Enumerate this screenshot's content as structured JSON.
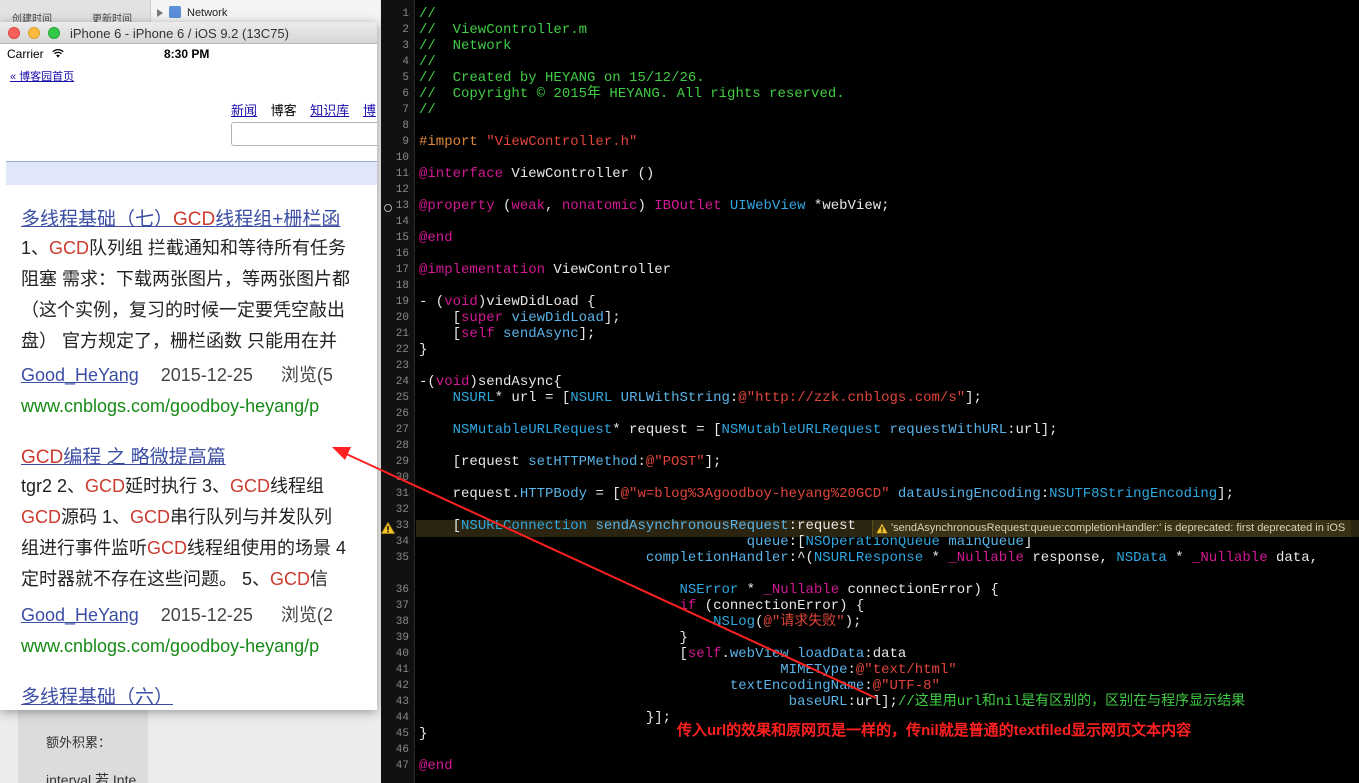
{
  "background": {
    "tab_left": "创建时间",
    "tab_right": "更新时间",
    "navigator_group": "Network",
    "lower_label": "额外积累：",
    "lower_text": "interval 若 Inte..."
  },
  "simulator": {
    "title": "iPhone 6 - iPhone 6 / iOS 9.2 (13C75)",
    "carrier": "Carrier",
    "time": "8:30 PM"
  },
  "webpage": {
    "home_link": "« 博客园首页",
    "nav": [
      "新闻",
      "博客",
      "知识库",
      "博"
    ],
    "results": [
      {
        "title_parts": [
          "多线程基础（七）",
          "GCD",
          "线程组+栅栏函"
        ],
        "lines": [
          [
            "1、",
            "GCD",
            "队列组 拦截通知和等待所有任务"
          ],
          [
            "阻塞 需求：下载两张图片，等两张图片都"
          ],
          [
            "（这个实例，复习的时候一定要凭空敲出"
          ],
          [
            "盘） 官方规定了，栅栏函数 只能用在并"
          ]
        ],
        "author": "Good_HeYang",
        "date": "2015-12-25",
        "views": "浏览(5",
        "url": "www.cnblogs.com/goodboy-heyang/p"
      },
      {
        "title_parts": [
          "GCD",
          "编程 之 略微提高篇"
        ],
        "lines": [
          [
            "tgr2 2、",
            "GCD",
            "延时执行 3、",
            "GCD",
            "线程组"
          ],
          [
            "GCD",
            "源码 1、",
            "GCD",
            "串行队列与并发队列"
          ],
          [
            "组进行事件监听",
            "GCD",
            "线程组使用的场景 4"
          ],
          [
            "定时器就不存在这些问题。 5、",
            "GCD",
            "信"
          ]
        ],
        "author": "Good_HeYang",
        "date": "2015-12-25",
        "views": "浏览(2",
        "url": "www.cnblogs.com/goodboy-heyang/p"
      },
      {
        "title_parts": [
          "多线程基础（六）"
        ]
      }
    ]
  },
  "editor": {
    "line_numbers": [
      "1",
      "2",
      "3",
      "4",
      "5",
      "6",
      "7",
      "8",
      "9",
      "10",
      "11",
      "12",
      "13",
      "14",
      "15",
      "16",
      "17",
      "18",
      "19",
      "20",
      "21",
      "22",
      "23",
      "24",
      "25",
      "26",
      "27",
      "28",
      "29",
      "30",
      "31",
      "32",
      "33",
      "34",
      "35",
      "36",
      "37",
      "38",
      "39",
      "40",
      "41",
      "42",
      "43",
      "44",
      "45",
      "46",
      "47"
    ],
    "code": [
      [
        [
          "c",
          "//"
        ]
      ],
      [
        [
          "c",
          "//  ViewController.m"
        ]
      ],
      [
        [
          "c",
          "//  Network"
        ]
      ],
      [
        [
          "c",
          "//"
        ]
      ],
      [
        [
          "c",
          "//  Created by HEYANG on 15/12/26."
        ]
      ],
      [
        [
          "c",
          "//  Copyright © 2015年 HEYANG. All rights reserved."
        ]
      ],
      [
        [
          "c",
          "//"
        ]
      ],
      [],
      [
        [
          "pp",
          "#import "
        ],
        [
          "s",
          "\"ViewController.h\""
        ]
      ],
      [],
      [
        [
          "k",
          "@interface "
        ],
        [
          "w",
          "ViewController ()"
        ]
      ],
      [],
      [
        [
          "k",
          "@property "
        ],
        [
          "w",
          "("
        ],
        [
          "k",
          "weak"
        ],
        [
          "w",
          ", "
        ],
        [
          "k",
          "nonatomic"
        ],
        [
          "w",
          ") "
        ],
        [
          "k",
          "IBOutlet "
        ],
        [
          "t2",
          "UIWebView "
        ],
        [
          "w",
          "*webView;"
        ]
      ],
      [],
      [
        [
          "k",
          "@end"
        ]
      ],
      [],
      [
        [
          "k",
          "@implementation "
        ],
        [
          "w",
          "ViewController"
        ]
      ],
      [],
      [
        [
          "w",
          "- ("
        ],
        [
          "k",
          "void"
        ],
        [
          "w",
          ")viewDidLoad {"
        ]
      ],
      [
        [
          "w",
          "    ["
        ],
        [
          "k",
          "super "
        ],
        [
          "m",
          "viewDidLoad"
        ],
        [
          "w",
          "];"
        ]
      ],
      [
        [
          "w",
          "    ["
        ],
        [
          "k",
          "self "
        ],
        [
          "m",
          "sendAsync"
        ],
        [
          "w",
          "];"
        ]
      ],
      [
        [
          "w",
          "}"
        ]
      ],
      [],
      [
        [
          "w",
          "-("
        ],
        [
          "k",
          "void"
        ],
        [
          "w",
          ")sendAsync{"
        ]
      ],
      [
        [
          "w",
          "    "
        ],
        [
          "t2",
          "NSURL"
        ],
        [
          "w",
          "* url = ["
        ],
        [
          "t2",
          "NSURL "
        ],
        [
          "m",
          "URLWithString"
        ],
        [
          "w",
          ":"
        ],
        [
          "s",
          "@\"http://zzk.cnblogs.com/s\""
        ],
        [
          "w",
          "];"
        ]
      ],
      [],
      [
        [
          "w",
          "    "
        ],
        [
          "t2",
          "NSMutableURLRequest"
        ],
        [
          "w",
          "* request = ["
        ],
        [
          "t2",
          "NSMutableURLRequest "
        ],
        [
          "m",
          "requestWithURL"
        ],
        [
          "w",
          ":url];"
        ]
      ],
      [],
      [
        [
          "w",
          "    [request "
        ],
        [
          "m",
          "setHTTPMethod"
        ],
        [
          "w",
          ":"
        ],
        [
          "s",
          "@\"POST\""
        ],
        [
          "w",
          "];"
        ]
      ],
      [],
      [
        [
          "w",
          "    request."
        ],
        [
          "m",
          "HTTPBody"
        ],
        [
          "w",
          " = ["
        ],
        [
          "s",
          "@\"w=blog%3Agoodboy-heyang%20GCD\" "
        ],
        [
          "m",
          "dataUsingEncoding"
        ],
        [
          "w",
          ":"
        ],
        [
          "t2",
          "NSUTF8StringEncoding"
        ],
        [
          "w",
          "];"
        ]
      ],
      [],
      [
        [
          "w",
          "    ["
        ],
        [
          "t2",
          "NSURLConnection "
        ],
        [
          "m",
          "sendAsynchronousRequest"
        ],
        [
          "w",
          ":request"
        ]
      ],
      [
        [
          "w",
          "                                       "
        ],
        [
          "m",
          "queue"
        ],
        [
          "w",
          ":["
        ],
        [
          "t2",
          "NSOperationQueue "
        ],
        [
          "m",
          "mainQueue"
        ],
        [
          "w",
          "]"
        ]
      ],
      [
        [
          "w",
          "                           "
        ],
        [
          "m",
          "completionHandler"
        ],
        [
          "w",
          ":^("
        ],
        [
          "t2",
          "NSURLResponse "
        ],
        [
          "w",
          "* "
        ],
        [
          "k",
          "_Nullable "
        ],
        [
          "w",
          "response, "
        ],
        [
          "t2",
          "NSData "
        ],
        [
          "w",
          "* "
        ],
        [
          "k",
          "_Nullable "
        ],
        [
          "w",
          "data,"
        ]
      ],
      [
        [
          "w",
          "                               "
        ],
        [
          "t2",
          "NSError "
        ],
        [
          "w",
          "* "
        ],
        [
          "k",
          "_Nullable "
        ],
        [
          "w",
          "connectionError) {"
        ]
      ],
      [
        [
          "w",
          "                               "
        ],
        [
          "k",
          "if "
        ],
        [
          "w",
          "(connectionError) {"
        ]
      ],
      [
        [
          "w",
          "                                   "
        ],
        [
          "t2",
          "NSLog"
        ],
        [
          "w",
          "("
        ],
        [
          "s",
          "@\"请求失败\""
        ],
        [
          "w",
          ");"
        ]
      ],
      [
        [
          "w",
          "                               }"
        ]
      ],
      [
        [
          "w",
          "                               ["
        ],
        [
          "k",
          "self"
        ],
        [
          "w",
          "."
        ],
        [
          "m",
          "webView "
        ],
        [
          "m",
          "loadData"
        ],
        [
          "w",
          ":data"
        ]
      ],
      [
        [
          "w",
          "                                           "
        ],
        [
          "m",
          "MIMEType"
        ],
        [
          "w",
          ":"
        ],
        [
          "s",
          "@\"text/html\""
        ]
      ],
      [
        [
          "w",
          "                                     "
        ],
        [
          "m",
          "textEncodingName"
        ],
        [
          "w",
          ":"
        ],
        [
          "s",
          "@\"UTF-8\""
        ]
      ],
      [
        [
          "w",
          "                                            "
        ],
        [
          "m",
          "baseURL"
        ],
        [
          "w",
          ":url];"
        ],
        [
          "cmt",
          "//这里用url和nil是有区别的，区别在与程序显示结果"
        ]
      ],
      [
        [
          "w",
          "                           }];"
        ]
      ],
      [
        [
          "w",
          "}"
        ]
      ],
      [],
      [
        [
          "k",
          "@end"
        ]
      ]
    ],
    "warning": "'sendAsynchronousRequest:queue:completionHandler:' is deprecated: first deprecated in iOS",
    "annotation": "传入url的效果和原网页是一样的，传nil就是普通的textfiled显示网页文本内容",
    "accent_colors": {
      "comment": "#41cc45",
      "keyword": "#d31895",
      "string": "#e0453a",
      "annotation": "#ff2020"
    }
  }
}
